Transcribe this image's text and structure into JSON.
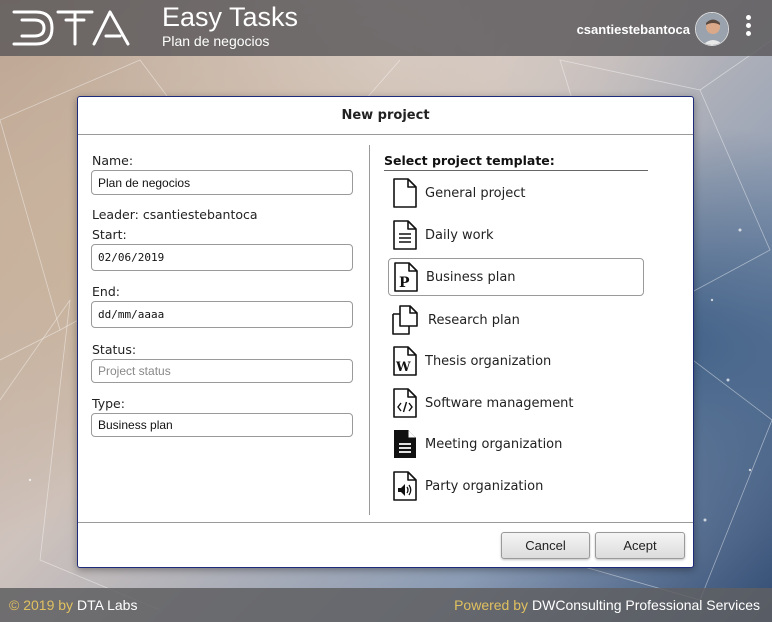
{
  "header": {
    "logo_text": "DTA",
    "title": "Easy Tasks",
    "subtitle": "Plan de negocios",
    "username": "csantiestebantoca"
  },
  "dialog": {
    "title": "New project",
    "form": {
      "name_label": "Name:",
      "name_value": "Plan de negocios",
      "leader_text": "Leader: csantiestebantoca",
      "start_label": "Start:",
      "start_value": "02/06/2019",
      "end_label": "End:",
      "end_value": "dd/mm/aaaa",
      "status_label": "Status:",
      "status_placeholder": "Project status",
      "type_label": "Type:",
      "type_value": "Business plan"
    },
    "templates": {
      "heading": "Select project template:",
      "items": [
        {
          "label": "General project",
          "icon": "blank-document-icon",
          "selected": false
        },
        {
          "label": "Daily work",
          "icon": "lined-document-icon",
          "selected": false
        },
        {
          "label": "Business plan",
          "icon": "p-document-icon",
          "selected": true
        },
        {
          "label": "Research plan",
          "icon": "copy-documents-icon",
          "selected": false
        },
        {
          "label": "Thesis organization",
          "icon": "w-document-icon",
          "selected": false
        },
        {
          "label": "Software management",
          "icon": "code-document-icon",
          "selected": false
        },
        {
          "label": "Meeting organization",
          "icon": "filled-document-icon",
          "selected": false
        },
        {
          "label": "Party organization",
          "icon": "speaker-document-icon",
          "selected": false
        }
      ]
    },
    "buttons": {
      "cancel": "Cancel",
      "accept": "Acept"
    }
  },
  "footer": {
    "copyright": "© 2019 by",
    "company": "DTA Labs",
    "powered_by": "Powered by",
    "provider": "DWConsulting Professional Services"
  },
  "colors": {
    "accent": "#1e2a7a",
    "footer_highlight": "#e0c060"
  }
}
